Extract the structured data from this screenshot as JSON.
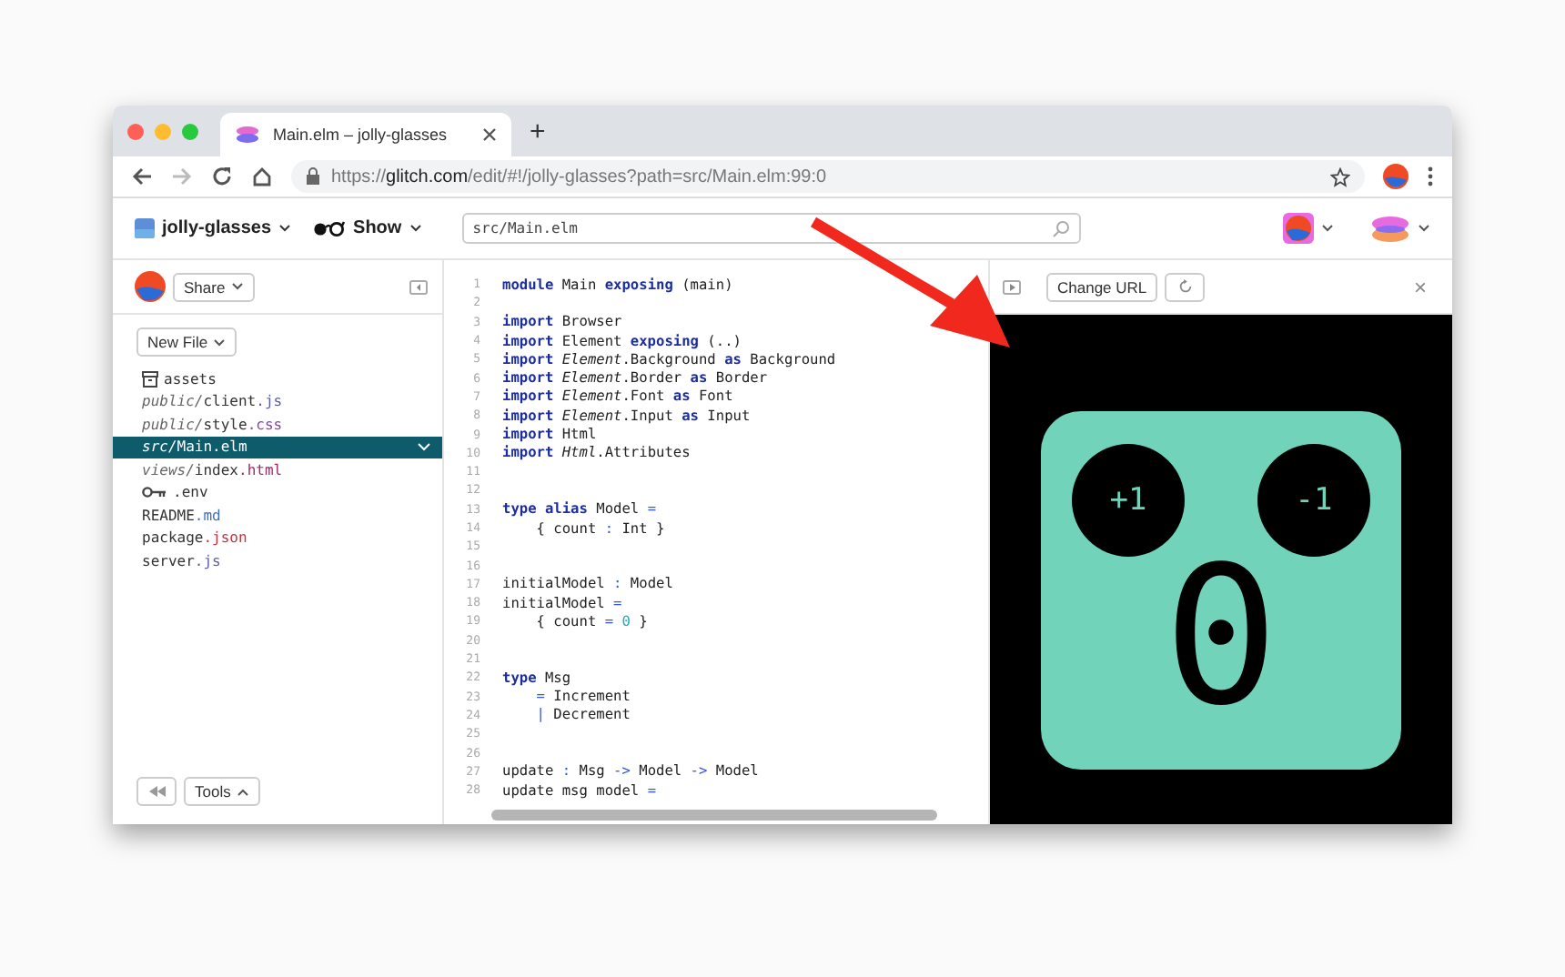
{
  "browser": {
    "tab_title": "Main.elm – jolly-glasses",
    "new_tab": "+",
    "url": [
      {
        "text": "https://",
        "emphasis": false
      },
      {
        "text": "glitch.com",
        "emphasis": true
      },
      {
        "text": "/edit/#!/jolly-glasses?path=src/Main.elm:99:0",
        "emphasis": false
      }
    ]
  },
  "header": {
    "project": "jolly-glasses",
    "show": "Show",
    "search": "src/Main.elm"
  },
  "sidebar": {
    "share": "Share",
    "new_file": "New File",
    "tools": "Tools",
    "files": [
      {
        "kind": "folder",
        "selected": false,
        "parts": [
          {
            "t": "assets",
            "kind": "name"
          }
        ]
      },
      {
        "kind": "file",
        "selected": false,
        "parts": [
          {
            "t": "public/",
            "kind": "dir"
          },
          {
            "t": "client",
            "kind": "name"
          },
          {
            "t": ".js",
            "kind": "ext",
            "color": "#5b5bb5"
          }
        ]
      },
      {
        "kind": "file",
        "selected": false,
        "parts": [
          {
            "t": "public/",
            "kind": "dir"
          },
          {
            "t": "style",
            "kind": "name"
          },
          {
            "t": ".css",
            "kind": "ext",
            "color": "#8a3fb8"
          }
        ]
      },
      {
        "kind": "file",
        "selected": true,
        "parts": [
          {
            "t": "src/",
            "kind": "dir"
          },
          {
            "t": "Main.elm",
            "kind": "name"
          }
        ]
      },
      {
        "kind": "file",
        "selected": false,
        "parts": [
          {
            "t": "views/",
            "kind": "dir"
          },
          {
            "t": "index",
            "kind": "name"
          },
          {
            "t": ".html",
            "kind": "ext",
            "color": "#a32a6a"
          }
        ]
      },
      {
        "kind": "key",
        "selected": false,
        "parts": [
          {
            "t": ".env",
            "kind": "name"
          }
        ]
      },
      {
        "kind": "file",
        "selected": false,
        "parts": [
          {
            "t": "README",
            "kind": "name"
          },
          {
            "t": ".md",
            "kind": "ext",
            "color": "#3f6fc0"
          }
        ]
      },
      {
        "kind": "file",
        "selected": false,
        "parts": [
          {
            "t": "package",
            "kind": "name"
          },
          {
            "t": ".json",
            "kind": "ext",
            "color": "#c8323a"
          }
        ]
      },
      {
        "kind": "file",
        "selected": false,
        "parts": [
          {
            "t": "server",
            "kind": "name"
          },
          {
            "t": ".js",
            "kind": "ext",
            "color": "#5b5bb5"
          }
        ]
      }
    ]
  },
  "editor": {
    "lines": [
      {
        "n": "1",
        "tokens": [
          {
            "t": "module",
            "kind": "kw"
          },
          {
            "t": " Main ",
            "kind": "plain"
          },
          {
            "t": "exposing",
            "kind": "kw"
          },
          {
            "t": " (main)",
            "kind": "plain"
          }
        ]
      },
      {
        "n": "2"
      },
      {
        "n": "3",
        "tokens": [
          {
            "t": "import",
            "kind": "kw"
          },
          {
            "t": " Browser",
            "kind": "plain"
          }
        ]
      },
      {
        "n": "4",
        "tokens": [
          {
            "t": "import",
            "kind": "kw"
          },
          {
            "t": " Element ",
            "kind": "plain"
          },
          {
            "t": "exposing",
            "kind": "kw"
          },
          {
            "t": " (..)",
            "kind": "plain"
          }
        ]
      },
      {
        "n": "5",
        "tokens": [
          {
            "t": "import",
            "kind": "kw"
          },
          {
            "t": " Element",
            "kind": "italic"
          },
          {
            "t": ".Background ",
            "kind": "plain"
          },
          {
            "t": "as",
            "kind": "kw"
          },
          {
            "t": " Background",
            "kind": "plain"
          }
        ]
      },
      {
        "n": "6",
        "tokens": [
          {
            "t": "import",
            "kind": "kw"
          },
          {
            "t": " Element",
            "kind": "italic"
          },
          {
            "t": ".Border ",
            "kind": "plain"
          },
          {
            "t": "as",
            "kind": "kw"
          },
          {
            "t": " Border",
            "kind": "plain"
          }
        ]
      },
      {
        "n": "7",
        "tokens": [
          {
            "t": "import",
            "kind": "kw"
          },
          {
            "t": " Element",
            "kind": "italic"
          },
          {
            "t": ".Font ",
            "kind": "plain"
          },
          {
            "t": "as",
            "kind": "kw"
          },
          {
            "t": " Font",
            "kind": "plain"
          }
        ]
      },
      {
        "n": "8",
        "tokens": [
          {
            "t": "import",
            "kind": "kw"
          },
          {
            "t": " Element",
            "kind": "italic"
          },
          {
            "t": ".Input ",
            "kind": "plain"
          },
          {
            "t": "as",
            "kind": "kw"
          },
          {
            "t": " Input",
            "kind": "plain"
          }
        ]
      },
      {
        "n": "9",
        "tokens": [
          {
            "t": "import",
            "kind": "kw"
          },
          {
            "t": " Html",
            "kind": "plain"
          }
        ]
      },
      {
        "n": "10",
        "tokens": [
          {
            "t": "import",
            "kind": "kw"
          },
          {
            "t": " Html",
            "kind": "italic"
          },
          {
            "t": ".Attributes",
            "kind": "plain"
          }
        ]
      },
      {
        "n": "11"
      },
      {
        "n": "12"
      },
      {
        "n": "13",
        "tokens": [
          {
            "t": "type",
            "kind": "kw"
          },
          {
            "t": " alias",
            "kind": "kw"
          },
          {
            "t": " Model ",
            "kind": "plain"
          },
          {
            "t": "=",
            "kind": "op"
          }
        ]
      },
      {
        "n": "14",
        "tokens": [
          {
            "t": "    { count ",
            "kind": "plain"
          },
          {
            "t": ":",
            "kind": "op"
          },
          {
            "t": " Int }",
            "kind": "plain"
          }
        ]
      },
      {
        "n": "15"
      },
      {
        "n": "16"
      },
      {
        "n": "17",
        "tokens": [
          {
            "t": "initialModel ",
            "kind": "plain"
          },
          {
            "t": ":",
            "kind": "op"
          },
          {
            "t": " Model",
            "kind": "plain"
          }
        ]
      },
      {
        "n": "18",
        "tokens": [
          {
            "t": "initialModel ",
            "kind": "plain"
          },
          {
            "t": "=",
            "kind": "op"
          }
        ]
      },
      {
        "n": "19",
        "tokens": [
          {
            "t": "    { count ",
            "kind": "plain"
          },
          {
            "t": "=",
            "kind": "op"
          },
          {
            "t": " 0",
            "kind": "num"
          },
          {
            "t": " }",
            "kind": "plain"
          }
        ]
      },
      {
        "n": "20"
      },
      {
        "n": "21"
      },
      {
        "n": "22",
        "tokens": [
          {
            "t": "type",
            "kind": "kw"
          },
          {
            "t": " Msg",
            "kind": "plain"
          }
        ]
      },
      {
        "n": "23",
        "tokens": [
          {
            "t": "    =",
            "kind": "op"
          },
          {
            "t": " Increment",
            "kind": "plain"
          }
        ]
      },
      {
        "n": "24",
        "tokens": [
          {
            "t": "    |",
            "kind": "op"
          },
          {
            "t": " Decrement",
            "kind": "plain"
          }
        ]
      },
      {
        "n": "25"
      },
      {
        "n": "26"
      },
      {
        "n": "27",
        "tokens": [
          {
            "t": "update ",
            "kind": "plain"
          },
          {
            "t": ":",
            "kind": "op"
          },
          {
            "t": " Msg ",
            "kind": "plain"
          },
          {
            "t": "->",
            "kind": "op"
          },
          {
            "t": " Model ",
            "kind": "plain"
          },
          {
            "t": "->",
            "kind": "op"
          },
          {
            "t": " Model",
            "kind": "plain"
          }
        ]
      },
      {
        "n": "28",
        "tokens": [
          {
            "t": "update msg model ",
            "kind": "plain"
          },
          {
            "t": "=",
            "kind": "op"
          }
        ]
      }
    ]
  },
  "preview": {
    "change_url": "Change URL",
    "close": "×",
    "app": {
      "increment": "+1",
      "decrement": "-1",
      "count": "0"
    }
  }
}
